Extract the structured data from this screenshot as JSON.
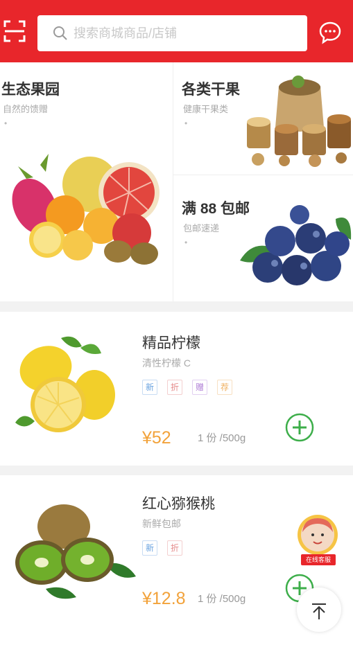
{
  "header": {
    "search_placeholder": "搜索商城商品/店铺",
    "accent_color": "#e8262b",
    "scan_icon": "scan-icon",
    "message_icon": "message-icon"
  },
  "promo": {
    "cells": [
      {
        "title": "生态果园",
        "subtitle": "自然的馈赠",
        "dot": "•"
      },
      {
        "title": "各类干果",
        "subtitle": "健康干果类",
        "dot": "•"
      },
      {
        "title": "满 88 包邮",
        "subtitle": "包邮速递",
        "dot": "•"
      }
    ]
  },
  "products": [
    {
      "name": "精品柠檬",
      "subtitle": "清性柠檬 C",
      "tags": [
        {
          "text": "新",
          "color": "#6aa3e0"
        },
        {
          "text": "折",
          "color": "#e58a8a"
        },
        {
          "text": "赠",
          "color": "#b07fd6"
        },
        {
          "text": "荐",
          "color": "#f0b060"
        }
      ],
      "price": "¥52",
      "unit": "1 份 /500g"
    },
    {
      "name": "红心猕猴桃",
      "subtitle": "新鲜包邮",
      "tags": [
        {
          "text": "新",
          "color": "#6aa3e0"
        },
        {
          "text": "折",
          "color": "#e58a8a"
        }
      ],
      "price": "¥12.8",
      "unit": "1 份 /500g"
    }
  ],
  "floating": {
    "avatar_label": "在线客服",
    "back_to_top_icon": "back-to-top-icon"
  },
  "add_button_color": "#3dae4a"
}
